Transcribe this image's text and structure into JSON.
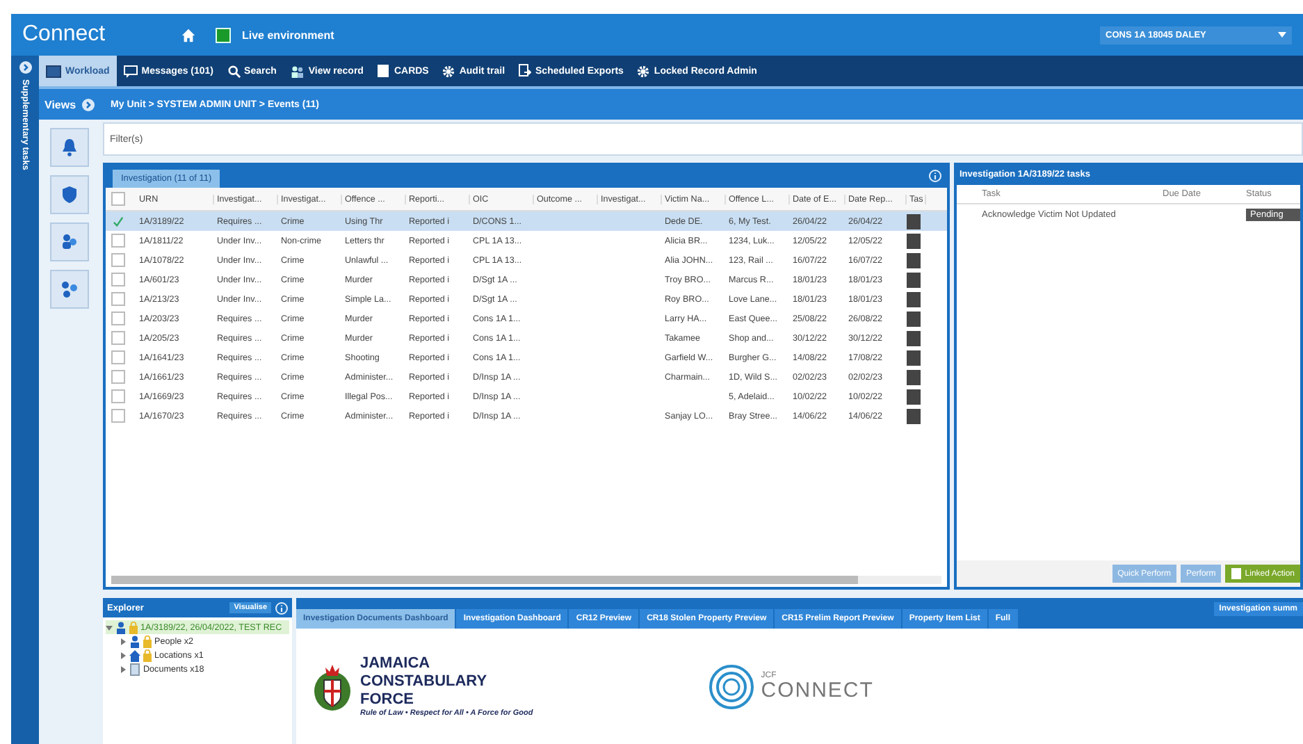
{
  "header": {
    "app_title": "Connect",
    "environment": "Live environment",
    "user": "CONS 1A 18045 DALEY"
  },
  "nav_tabs": [
    {
      "label": "Workload",
      "selected": true
    },
    {
      "label": "Messages (101)",
      "selected": false
    },
    {
      "label": "Search",
      "selected": false
    },
    {
      "label": "View record",
      "selected": false
    },
    {
      "label": "CARDS",
      "selected": false
    },
    {
      "label": "Audit trail",
      "selected": false
    },
    {
      "label": "Scheduled Exports",
      "selected": false
    },
    {
      "label": "Locked Record Admin",
      "selected": false
    }
  ],
  "side_strip": {
    "label": "Supplementary tasks"
  },
  "views_bar": {
    "label": "Views",
    "breadcrumb": "My Unit > SYSTEM ADMIN UNIT > Events (11)"
  },
  "filter": {
    "label": "Filter(s)"
  },
  "investigations": {
    "tab": "Investigation (11 of 11)",
    "select_all_checked": false,
    "columns": [
      "URN",
      "Investigat...",
      "Investigat...",
      "Offence ...",
      "Reporti...",
      "OIC",
      "Outcome ...",
      "Investigat...",
      "Victim Na...",
      "Offence L...",
      "Date of E...",
      "Date Rep...",
      "Tas"
    ],
    "rows": [
      {
        "selected": true,
        "checked": true,
        "cells": [
          "1A/3189/22",
          "Requires ...",
          "Crime",
          "Using Thr",
          "Reported i",
          "D/CONS 1...",
          null,
          null,
          "Dede DE.",
          "6, My Test.",
          "26/04/22",
          "26/04/22"
        ]
      },
      {
        "selected": false,
        "checked": false,
        "cells": [
          "1A/1811/22",
          "Under Inv...",
          "Non-crime",
          "Letters thr",
          "Reported i",
          "CPL 1A 13...",
          null,
          null,
          "Alicia BR...",
          "1234, Luk...",
          "12/05/22",
          "12/05/22"
        ]
      },
      {
        "selected": false,
        "checked": false,
        "cells": [
          "1A/1078/22",
          "Under Inv...",
          "Crime",
          "Unlawful ...",
          "Reported i",
          "CPL 1A 13...",
          null,
          null,
          "Alia JOHN...",
          "123, Rail ...",
          "16/07/22",
          "16/07/22"
        ]
      },
      {
        "selected": false,
        "checked": false,
        "cells": [
          "1A/601/23",
          "Under Inv...",
          "Crime",
          "Murder",
          "Reported i",
          "D/Sgt 1A ...",
          null,
          null,
          "Troy BRO...",
          "Marcus R...",
          "18/01/23",
          "18/01/23"
        ]
      },
      {
        "selected": false,
        "checked": false,
        "cells": [
          "1A/213/23",
          "Under Inv...",
          "Crime",
          "Simple La...",
          "Reported i",
          "D/Sgt 1A ...",
          null,
          null,
          "Roy BRO...",
          "Love Lane...",
          "18/01/23",
          "18/01/23"
        ]
      },
      {
        "selected": false,
        "checked": false,
        "cells": [
          "1A/203/23",
          "Requires ...",
          "Crime",
          "Murder",
          "Reported i",
          "Cons 1A 1...",
          null,
          null,
          "Larry HA...",
          "East Quee...",
          "25/08/22",
          "26/08/22"
        ]
      },
      {
        "selected": false,
        "checked": false,
        "cells": [
          "1A/205/23",
          "Requires ...",
          "Crime",
          "Murder",
          "Reported i",
          "Cons 1A 1...",
          null,
          null,
          "Takamee",
          "Shop and...",
          "30/12/22",
          "30/12/22"
        ]
      },
      {
        "selected": false,
        "checked": false,
        "cells": [
          "1A/1641/23",
          "Requires ...",
          "Crime",
          "Shooting",
          "Reported i",
          "Cons 1A 1...",
          null,
          null,
          "Garfield W...",
          "Burgher G...",
          "14/08/22",
          "17/08/22"
        ]
      },
      {
        "selected": false,
        "checked": false,
        "cells": [
          "1A/1661/23",
          "Requires ...",
          "Crime",
          "Administer...",
          "Reported i",
          "D/Insp 1A ...",
          null,
          null,
          "Charmain...",
          "1D, Wild S...",
          "02/02/23",
          "02/02/23"
        ]
      },
      {
        "selected": false,
        "checked": false,
        "cells": [
          "1A/1669/23",
          "Requires ...",
          "Crime",
          "Illegal Pos...",
          "Reported i",
          "D/Insp 1A ...",
          null,
          null,
          null,
          "5, Adelaid...",
          "10/02/22",
          "10/02/22"
        ]
      },
      {
        "selected": false,
        "checked": false,
        "cells": [
          "1A/1670/23",
          "Requires ...",
          "Crime",
          "Administer...",
          "Reported i",
          "D/Insp 1A ...",
          null,
          null,
          "Sanjay LO...",
          "Bray Stree...",
          "14/06/22",
          "14/06/22"
        ]
      }
    ]
  },
  "tasks": {
    "title": "Investigation 1A/3189/22 tasks",
    "columns": [
      "Task",
      "Due Date",
      "Status"
    ],
    "rows": [
      {
        "task": "Acknowledge Victim Not Updated",
        "status": "Pending"
      }
    ],
    "buttons": [
      {
        "label": "Quick Perform",
        "kind": "plain"
      },
      {
        "label": "Perform",
        "kind": "plain"
      },
      {
        "label": "Linked Action",
        "kind": "primary"
      }
    ]
  },
  "explorer": {
    "title": "Explorer",
    "button": "Visualise",
    "tree": [
      {
        "label": "1A/3189/22, 26/04/2022, TEST REC",
        "selected": true,
        "expanded": true,
        "children": [
          {
            "label": "People x2",
            "selected": false,
            "expanded": false
          },
          {
            "label": "Locations x1",
            "selected": false,
            "expanded": false
          },
          {
            "label": "Documents x18",
            "selected": false,
            "expanded": false
          }
        ]
      }
    ]
  },
  "documents": {
    "summary_button": "Investigation summ",
    "tabs": [
      {
        "label": "Investigation Documents Dashboard",
        "selected": true
      },
      {
        "label": "Investigation Dashboard",
        "selected": false
      },
      {
        "label": "CR12 Preview",
        "selected": false
      },
      {
        "label": "CR18 Stolen Property Preview",
        "selected": false
      },
      {
        "label": "CR15 Prelim Report Preview",
        "selected": false
      },
      {
        "label": "Property Item List",
        "selected": false
      },
      {
        "label": "Full",
        "selected": false
      }
    ],
    "banner": {
      "org_lines": [
        "JAMAICA",
        "CONSTABULARY",
        "FORCE"
      ],
      "motto": "Rule of Law • Respect for All • A Force for Good",
      "logo_small": "JCF",
      "logo_large": "CONNECT"
    }
  }
}
